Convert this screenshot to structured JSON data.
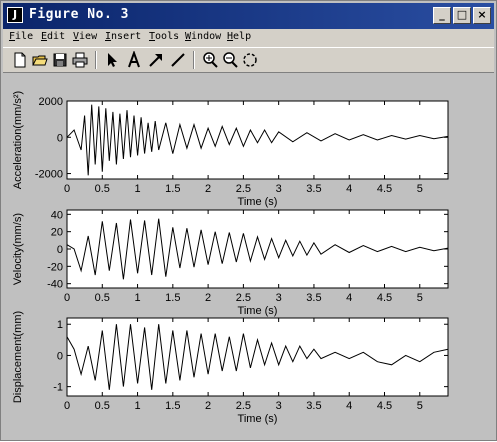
{
  "window": {
    "title": "Figure No. 3",
    "app_icon": "matlab-figure-icon",
    "controls": [
      "minimize-icon",
      "maximize-icon",
      "close-icon"
    ]
  },
  "menubar": {
    "items": [
      {
        "label": "File",
        "accel": "F"
      },
      {
        "label": "Edit",
        "accel": "E"
      },
      {
        "label": "View",
        "accel": "V"
      },
      {
        "label": "Insert",
        "accel": "I"
      },
      {
        "label": "Tools",
        "accel": "T"
      },
      {
        "label": "Window",
        "accel": "W"
      },
      {
        "label": "Help",
        "accel": "H"
      }
    ]
  },
  "toolbar": {
    "buttons": [
      "new-file-icon",
      "open-folder-icon",
      "save-icon",
      "print-icon",
      "select-arrow-icon",
      "insert-text-icon",
      "insert-arrow-icon",
      "insert-line-icon",
      "zoom-in-icon",
      "zoom-out-icon",
      "rotate-3d-icon"
    ]
  },
  "colors": {
    "title_bar": "#0a246a",
    "figure_bg": "#c0c0c0",
    "axes_bg": "#ffffff",
    "line": "#000000"
  },
  "chart_data": [
    {
      "type": "line",
      "ylabel": "Acceleration(mm/s²)",
      "xlabel": "Time (s)",
      "xlim": [
        0,
        5.4
      ],
      "ylim": [
        -2300,
        2000
      ],
      "yticks": [
        -2000,
        0,
        2000
      ],
      "xticks": [
        0,
        0.5,
        1,
        1.5,
        2,
        2.5,
        3,
        3.5,
        4,
        4.5,
        5
      ],
      "grid": false,
      "series": [
        {
          "x": [
            0,
            0.1,
            0.2,
            0.25,
            0.3,
            0.35,
            0.4,
            0.45,
            0.5,
            0.55,
            0.6,
            0.65,
            0.7,
            0.75,
            0.8,
            0.85,
            0.9,
            0.95,
            1.0,
            1.05,
            1.1,
            1.15,
            1.2,
            1.25,
            1.3,
            1.4,
            1.5,
            1.6,
            1.7,
            1.8,
            1.9,
            2.0,
            2.1,
            2.2,
            2.3,
            2.4,
            2.5,
            2.6,
            2.7,
            2.8,
            2.9,
            3.0,
            3.2,
            3.4,
            3.6,
            3.8,
            4.0,
            4.2,
            4.4,
            4.6,
            4.8,
            5.0,
            5.2,
            5.4
          ],
          "y": [
            0,
            400,
            -700,
            1200,
            -2100,
            1800,
            -1500,
            1700,
            -1900,
            1600,
            -1300,
            1400,
            -1500,
            1300,
            -1200,
            1500,
            -1100,
            1200,
            -1000,
            1100,
            -900,
            800,
            -800,
            900,
            -700,
            800,
            -900,
            700,
            -600,
            700,
            -600,
            500,
            -500,
            600,
            -400,
            500,
            -500,
            400,
            -300,
            400,
            -300,
            300,
            -250,
            250,
            -200,
            200,
            -150,
            150,
            -150,
            100,
            -100,
            100,
            -80,
            50
          ]
        }
      ]
    },
    {
      "type": "line",
      "ylabel": "Velocity(mm/s)",
      "xlabel": "Time (s)",
      "xlim": [
        0,
        5.4
      ],
      "ylim": [
        -45,
        45
      ],
      "yticks": [
        -40,
        -20,
        0,
        20,
        40
      ],
      "xticks": [
        0,
        0.5,
        1,
        1.5,
        2,
        2.5,
        3,
        3.5,
        4,
        4.5,
        5
      ],
      "grid": false,
      "series": [
        {
          "x": [
            0,
            0.1,
            0.2,
            0.3,
            0.4,
            0.5,
            0.6,
            0.7,
            0.8,
            0.9,
            1.0,
            1.1,
            1.2,
            1.3,
            1.4,
            1.5,
            1.6,
            1.7,
            1.8,
            1.9,
            2.0,
            2.1,
            2.2,
            2.3,
            2.4,
            2.5,
            2.6,
            2.7,
            2.8,
            2.9,
            3.0,
            3.1,
            3.2,
            3.3,
            3.4,
            3.5,
            3.6,
            3.8,
            4.0,
            4.2,
            4.4,
            4.6,
            4.8,
            5.0,
            5.2,
            5.4
          ],
          "y": [
            5,
            0,
            -25,
            15,
            -30,
            32,
            -25,
            30,
            -35,
            34,
            -28,
            33,
            -30,
            35,
            -32,
            25,
            -22,
            24,
            -21,
            22,
            -18,
            20,
            -17,
            19,
            -15,
            18,
            -14,
            14,
            -12,
            12,
            -10,
            10,
            -8,
            9,
            -7,
            7,
            -6,
            5,
            -4,
            4,
            -3,
            3,
            -3,
            2,
            -2,
            1
          ]
        }
      ]
    },
    {
      "type": "line",
      "ylabel": "Displacement(mm)",
      "xlabel": "Time (s)",
      "xlim": [
        0,
        5.4
      ],
      "ylim": [
        -1.3,
        1.2
      ],
      "yticks": [
        -1,
        0,
        1
      ],
      "xticks": [
        0,
        0.5,
        1,
        1.5,
        2,
        2.5,
        3,
        3.5,
        4,
        4.5,
        5
      ],
      "grid": false,
      "series": [
        {
          "x": [
            0,
            0.1,
            0.2,
            0.3,
            0.4,
            0.5,
            0.6,
            0.7,
            0.8,
            0.9,
            1.0,
            1.1,
            1.2,
            1.3,
            1.4,
            1.5,
            1.6,
            1.7,
            1.8,
            1.9,
            2.0,
            2.1,
            2.2,
            2.3,
            2.4,
            2.5,
            2.6,
            2.7,
            2.8,
            2.9,
            3.0,
            3.1,
            3.2,
            3.3,
            3.4,
            3.5,
            3.6,
            3.8,
            4.0,
            4.2,
            4.4,
            4.6,
            4.8,
            5.0,
            5.2,
            5.4
          ],
          "y": [
            0.6,
            0.2,
            -0.6,
            0.3,
            -0.8,
            0.8,
            -1.1,
            1.0,
            -1.0,
            1.0,
            -0.9,
            0.9,
            -1.1,
            1.0,
            -0.9,
            0.8,
            -0.8,
            0.8,
            -0.7,
            0.7,
            -0.6,
            0.7,
            -0.5,
            0.6,
            -0.5,
            0.7,
            -0.4,
            0.5,
            -0.3,
            0.4,
            -0.3,
            0.3,
            -0.2,
            0.3,
            -0.1,
            0.2,
            -0.1,
            0.1,
            -0.1,
            0.1,
            -0.2,
            -0.3,
            0.0,
            -0.2,
            0.1,
            0.2
          ]
        }
      ]
    }
  ]
}
